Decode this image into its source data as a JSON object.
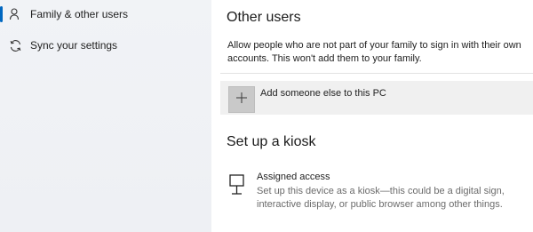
{
  "sidebar": {
    "items": [
      {
        "label": "Family & other users",
        "icon": "person-icon",
        "active": true
      },
      {
        "label": "Sync your settings",
        "icon": "sync-icon",
        "active": false
      }
    ]
  },
  "other_users": {
    "title": "Other users",
    "description": "Allow people who are not part of your family to sign in with their own accounts. This won't add them to your family.",
    "add_label": "Add someone else to this PC"
  },
  "kiosk": {
    "title": "Set up a kiosk",
    "item_title": "Assigned access",
    "item_description": "Set up this device as a kiosk—this could be a digital sign, interactive display, or public browser among other things."
  },
  "colors": {
    "accent": "#0067c0",
    "sidebar_bg": "#f1f3f6",
    "card_bg": "#f0f0f0"
  }
}
